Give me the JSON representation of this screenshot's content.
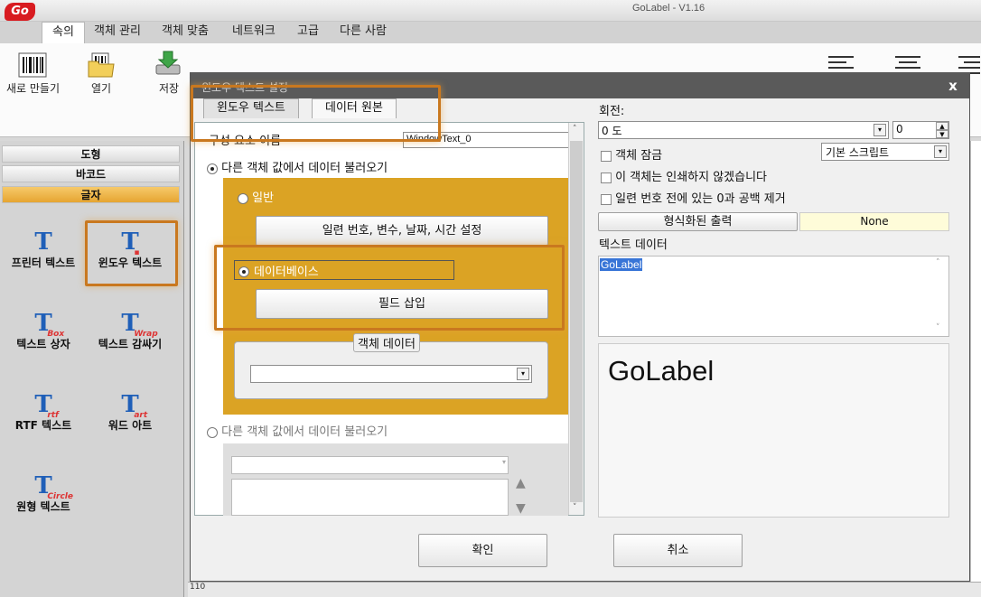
{
  "app": {
    "logo": "Go",
    "title": "GoLabel - V1.16"
  },
  "ribbon_tabs": [
    "속의",
    "객체 관리",
    "객체 맞춤",
    "네트워크",
    "고급",
    "다른 사람"
  ],
  "ribbon_buttons": {
    "new": "새로 만들기",
    "open": "열기",
    "save": "저장"
  },
  "palette": {
    "categories": [
      "도형",
      "바코드",
      "글자"
    ],
    "text_items": [
      "프린터 텍스트",
      "윈도우 텍스트",
      "텍스트 상자",
      "텍스트 감싸기",
      "RTF 텍스트",
      "워드 아트",
      "원형 텍스트"
    ]
  },
  "dialog": {
    "title": "윈도우 텍스트 설정",
    "close": "x",
    "tabs": [
      "윈도우 텍스트",
      "데이터 원본"
    ],
    "component_name_label": "구성 요소 이름",
    "component_name_value": "WindowText_0",
    "radio_load_other_1": "다른 객체 값에서 데이터 불러오기",
    "radio_general": "일반",
    "btn_serial_settings": "일련 번호, 변수, 날짜, 시간 설정",
    "radio_database": "데이터베이스",
    "btn_insert_field": "필드 삽입",
    "object_data_label": "객체 데이터",
    "radio_load_other_2": "다른 객체 값에서 데이터 불러오기",
    "rotation_label": "회전:",
    "rotation_value": "0 도",
    "rotation_num": "0",
    "chk_lock": "객체 잠금",
    "script_value": "기본 스크립트",
    "chk_no_print": "이 객체는 인쇄하지 않겠습니다",
    "chk_trim": "일련 번호 전에 있는 0과 공백 제거",
    "btn_format": "형식화된 출력",
    "format_value": "None",
    "text_data_label": "텍스트 데이터",
    "text_data_value": "GoLabel",
    "preview_text": "GoLabel",
    "ok": "확인",
    "cancel": "취소"
  },
  "status": {
    "ruler": "110"
  }
}
